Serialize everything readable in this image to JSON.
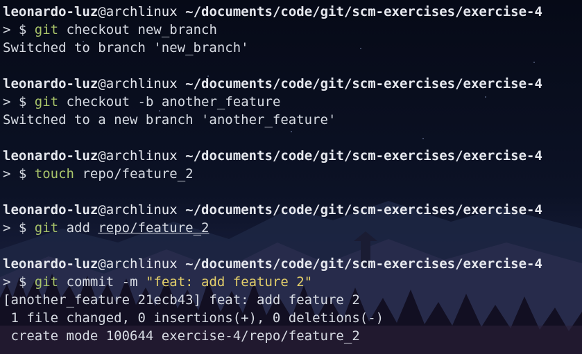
{
  "prompt": {
    "user": "leonardo-luz",
    "at": "@",
    "host": "archlinux",
    "path": "~/documents/code/git/scm-exercises/exercise-4",
    "marker": "> $"
  },
  "blocks": [
    {
      "command": {
        "name": "git",
        "args": "checkout new_branch"
      },
      "output": [
        "Switched to branch 'new_branch'"
      ]
    },
    {
      "command": {
        "name": "git",
        "args": "checkout -b another_feature"
      },
      "output": [
        "Switched to a new branch 'another_feature'"
      ]
    },
    {
      "command": {
        "name": "touch",
        "args": "repo/feature_2"
      },
      "output": []
    },
    {
      "command": {
        "name": "git",
        "args_plain": "add ",
        "args_underlined": "repo/feature_2"
      },
      "output": []
    },
    {
      "command": {
        "name": "git",
        "args_plain": "commit -m ",
        "args_string": "\"feat: add feature 2\""
      },
      "output": [
        "[another_feature 21ecb43] feat: add feature 2",
        " 1 file changed, 0 insertions(+), 0 deletions(-)",
        " create mode 100644 exercise-4/repo/feature_2"
      ]
    }
  ],
  "colors": {
    "command": "#a9c46a",
    "string": "#e3cf6a",
    "text": "#d7dbe3"
  }
}
